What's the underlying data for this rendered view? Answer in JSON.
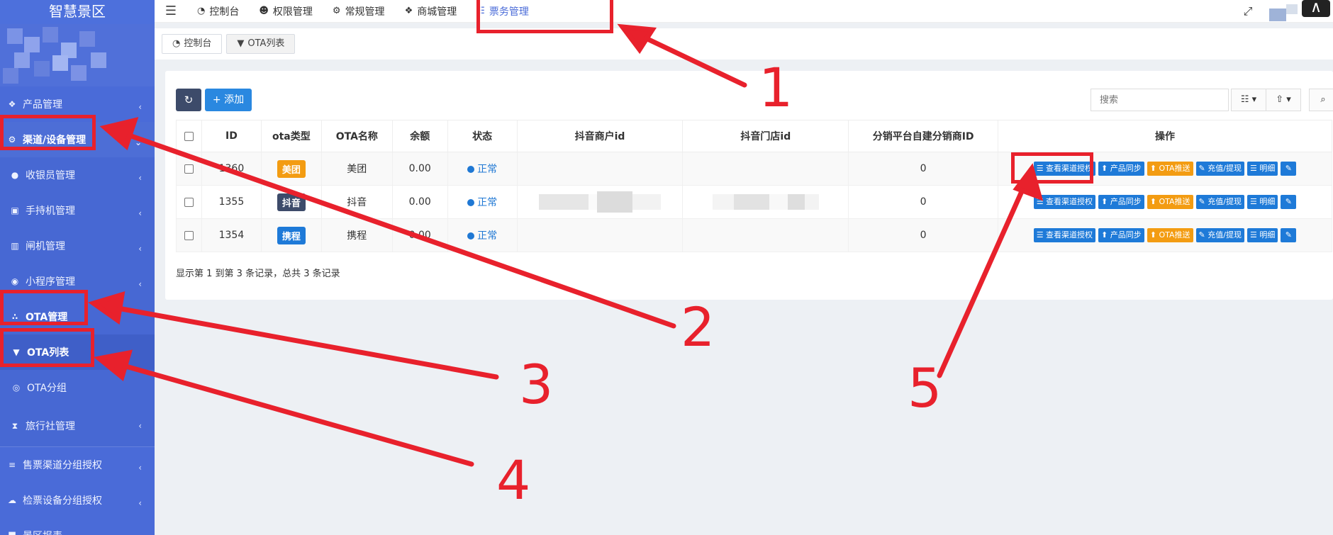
{
  "sidebar": {
    "logo": "智慧景区",
    "items": [
      {
        "label": "产品管理",
        "icon": "tag-icon",
        "caret": "‹"
      },
      {
        "label": "渠道/设备管理",
        "icon": "gears-icon",
        "caret": "⌄"
      },
      {
        "label": "收银员管理",
        "icon": "user-icon",
        "caret": "‹"
      },
      {
        "label": "手持机管理",
        "icon": "print-icon",
        "caret": "‹"
      },
      {
        "label": "闸机管理",
        "icon": "gate-icon",
        "caret": "‹"
      },
      {
        "label": "小程序管理",
        "icon": "wechat-icon",
        "caret": "‹"
      },
      {
        "label": "OTA管理",
        "icon": "share-icon",
        "caret": ""
      },
      {
        "label": "OTA列表",
        "icon": "shield-icon",
        "caret": ""
      },
      {
        "label": "OTA分组",
        "icon": "circle-icon",
        "caret": ""
      },
      {
        "label": "旅行社管理",
        "icon": "hourglass-icon",
        "caret": "‹"
      },
      {
        "label": "售票渠道分组授权",
        "icon": "database-icon",
        "caret": "‹"
      },
      {
        "label": "检票设备分组授权",
        "icon": "cloud-icon",
        "caret": "‹"
      },
      {
        "label": "景区报表",
        "icon": "chart-icon",
        "caret": "‹"
      }
    ]
  },
  "topnav": {
    "menu_icon": "☰",
    "items": [
      {
        "label": "控制台",
        "icon": "dashboard-icon"
      },
      {
        "label": "权限管理",
        "icon": "users-icon"
      },
      {
        "label": "常规管理",
        "icon": "cogs-icon"
      },
      {
        "label": "商城管理",
        "icon": "dropbox-icon"
      },
      {
        "label": "票务管理",
        "icon": "grid-icon"
      }
    ]
  },
  "tabs": [
    {
      "label": "控制台",
      "icon": "dashboard-icon"
    },
    {
      "label": "OTA列表",
      "icon": "shield-icon"
    }
  ],
  "toolbar": {
    "add_label": "添加",
    "search_placeholder": "搜索"
  },
  "table": {
    "headers": [
      "ID",
      "ota类型",
      "OTA名称",
      "余额",
      "状态",
      "抖音商户id",
      "抖音门店id",
      "分销平台自建分销商ID",
      "操作"
    ],
    "rows": [
      {
        "id": "1360",
        "type": "美团",
        "type_color": "#f39c12",
        "name": "美团",
        "balance": "0.00",
        "status": "正常",
        "merchant_id": "",
        "store_id": "",
        "dist_id": "0"
      },
      {
        "id": "1355",
        "type": "抖音",
        "type_color": "#3d4b6a",
        "name": "抖音",
        "balance": "0.00",
        "status": "正常",
        "merchant_id": "",
        "store_id": "",
        "dist_id": "0"
      },
      {
        "id": "1354",
        "type": "携程",
        "type_color": "#1e7ad8",
        "name": "携程",
        "balance": "0.00",
        "status": "正常",
        "merchant_id": "",
        "store_id": "",
        "dist_id": "0"
      }
    ],
    "actions": [
      "查看渠道授权",
      "产品同步",
      "OTA推送",
      "充值/提现",
      "明细"
    ]
  },
  "footer_info": "显示第 1 到第 3 条记录，总共 3 条记录",
  "annotations": [
    "1",
    "2",
    "3",
    "4",
    "5"
  ],
  "colors": {
    "sidebar": "#4a6bd8",
    "annotation": "#e8212c",
    "primary": "#1e7ad8"
  }
}
